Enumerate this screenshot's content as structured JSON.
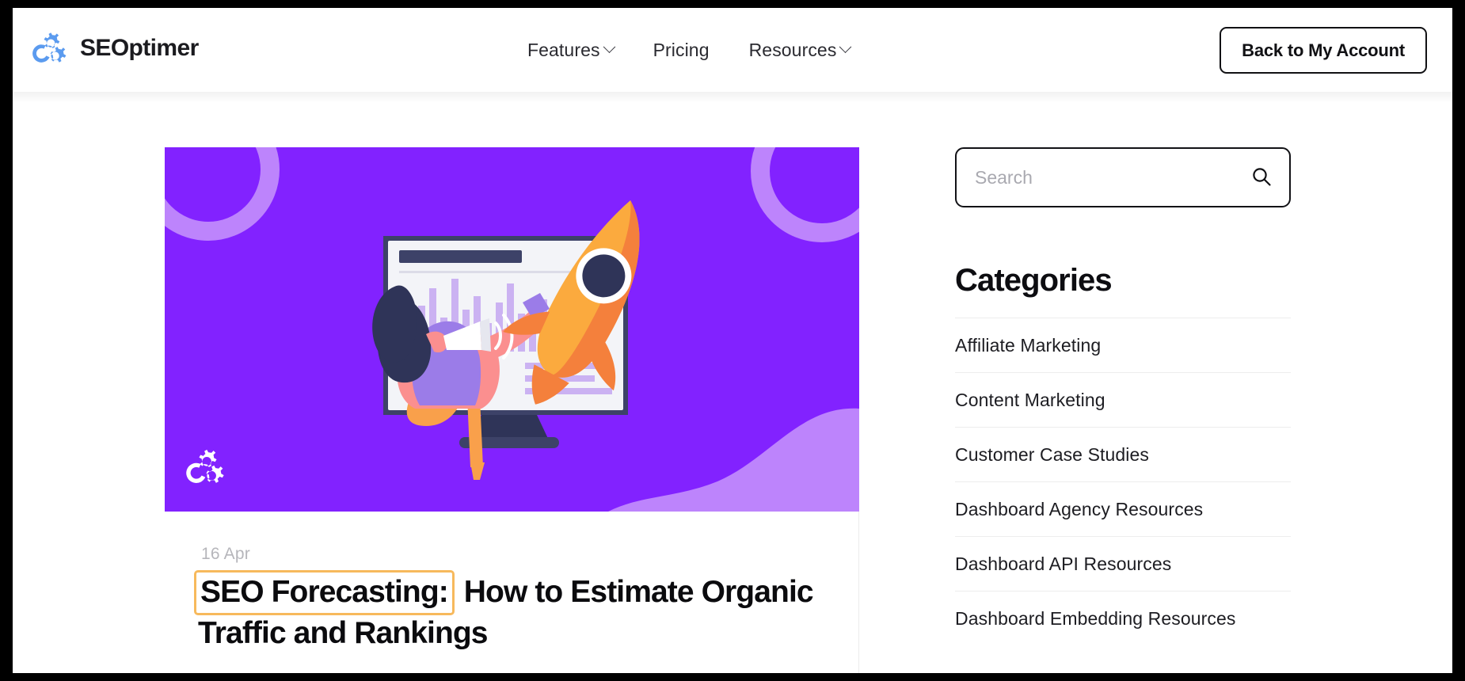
{
  "header": {
    "logo": {
      "icon": "seoptimer-gear-logo",
      "text": "SEOptimer",
      "color": "#5b9bef"
    },
    "nav": [
      {
        "label": "Features",
        "has_dropdown": true
      },
      {
        "label": "Pricing",
        "has_dropdown": false
      },
      {
        "label": "Resources",
        "has_dropdown": true
      }
    ],
    "account_button": "Back to My Account"
  },
  "article": {
    "date": "16 Apr",
    "title_highlight": "SEO Forecasting:",
    "title_rest": "How to Estimate Organic Traffic and Rankings",
    "highlight_color": "#f7b95c",
    "hero": {
      "background_color": "#8222ff",
      "accent_color": "#bd84fc",
      "illustration": "woman-with-megaphone-monitor-rocket",
      "watermark_icon": "seoptimer-gear-logo-white"
    }
  },
  "sidebar": {
    "search": {
      "placeholder": "Search",
      "value": "",
      "icon": "search-icon"
    },
    "categories_title": "Categories",
    "categories": [
      "Affiliate Marketing",
      "Content Marketing",
      "Customer Case Studies",
      "Dashboard Agency Resources",
      "Dashboard API Resources",
      "Dashboard Embedding Resources"
    ]
  }
}
